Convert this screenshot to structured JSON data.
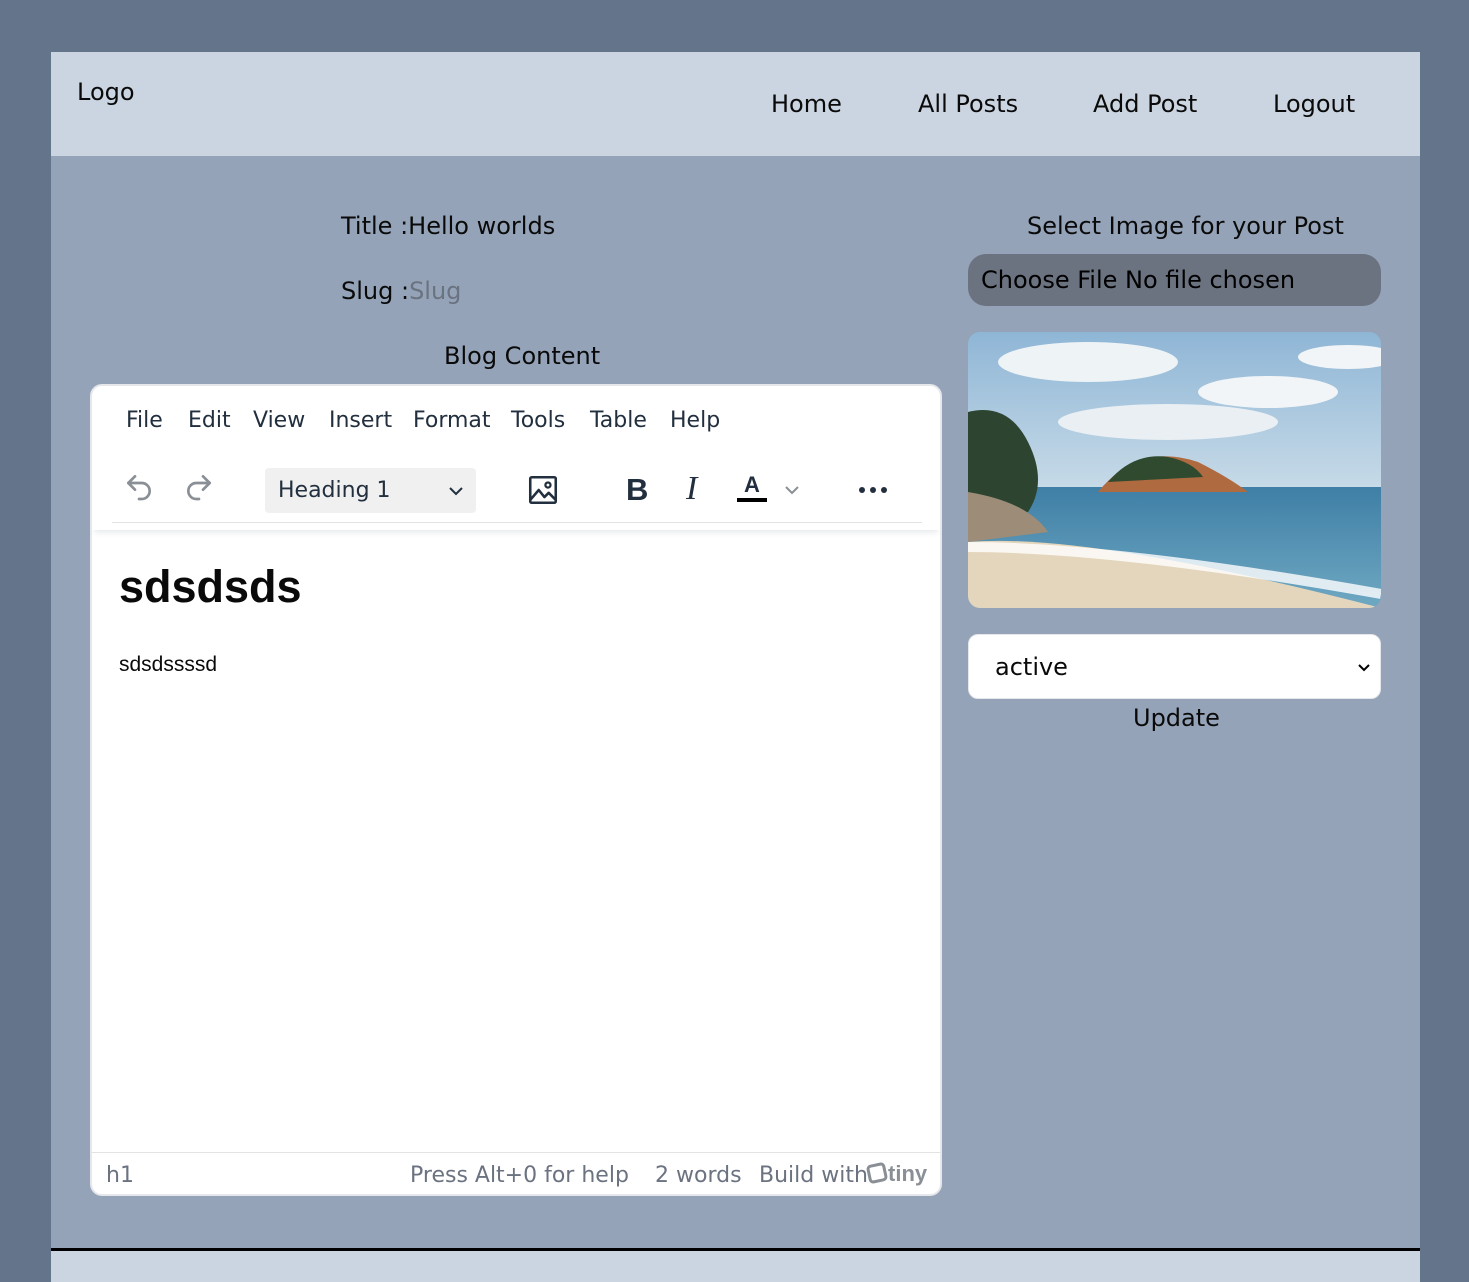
{
  "header": {
    "logo": "Logo",
    "nav": [
      {
        "label": "Home"
      },
      {
        "label": "All Posts"
      },
      {
        "label": "Add Post"
      },
      {
        "label": "Logout"
      }
    ]
  },
  "form": {
    "title_label": "Title :",
    "title_value": "Hello worlds",
    "slug_label": "Slug :",
    "slug_placeholder": "Slug",
    "content_label": "Blog Content",
    "image_label": "Select Image for your Post",
    "file_input_text": "Choose File No file chosen",
    "status_value": "active",
    "submit_label": "Update"
  },
  "editor": {
    "menu": [
      "File",
      "Edit",
      "View",
      "Insert",
      "Format",
      "Tools",
      "Table",
      "Help"
    ],
    "block_format": "Heading 1",
    "icons": [
      "undo-icon",
      "redo-icon",
      "image-icon",
      "bold-icon",
      "italic-icon",
      "text-color-icon",
      "more-icon"
    ],
    "content_heading": "sdsdsds",
    "content_paragraph": "sdsdssssd",
    "status_path": "h1",
    "help_hint": "Press Alt+0 for help",
    "word_count": "2 words",
    "branding": "Build with",
    "brand_logo_text": "tiny"
  },
  "colors": {
    "body_bg": "#64748b",
    "page_bg": "#94a3b8",
    "header_bg": "#cbd5e1",
    "file_input_bg": "#6b7280"
  }
}
